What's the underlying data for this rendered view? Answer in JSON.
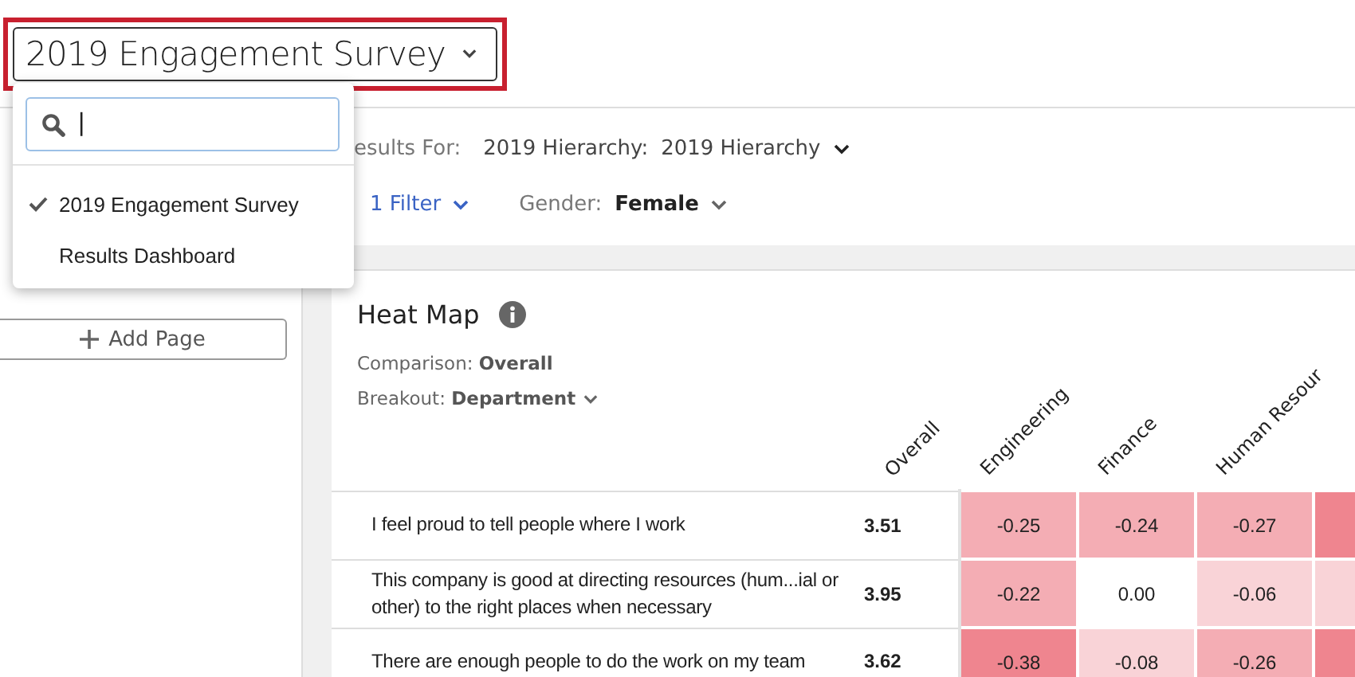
{
  "survey_selector": {
    "label": "2019 Engagement Survey",
    "highlighted": true
  },
  "dropdown": {
    "search": {
      "value": "|"
    },
    "items": [
      {
        "label": "2019 Engagement Survey",
        "selected": true
      },
      {
        "label": "Results Dashboard",
        "selected": false
      }
    ]
  },
  "sidebar": {
    "add_page": "Add Page"
  },
  "filter_bar": {
    "results_for_label": "esults For:",
    "hierarchy": "2019 Hierarchy:",
    "hierarchy_value": "2019 Hierarchy",
    "filter_count": "1 Filter",
    "gender_label": "Gender:",
    "gender_value": "Female"
  },
  "heat_map": {
    "title": "Heat Map",
    "comparison_label": "Comparison:",
    "comparison_value": "Overall",
    "breakout_label": "Breakout:",
    "breakout_value": "Department",
    "overall_column": "Overall",
    "columns": [
      "Engineering",
      "Finance",
      "Human Resour"
    ],
    "rows": [
      {
        "question": "I feel proud to tell people where I work",
        "overall": "3.51",
        "cells": [
          {
            "value": "-0.25",
            "color": "#f4adb4"
          },
          {
            "value": "-0.24",
            "color": "#f4adb4"
          },
          {
            "value": "-0.27",
            "color": "#f4adb4"
          },
          {
            "color": "#ef858f"
          }
        ]
      },
      {
        "question": "This company is good at directing resources (hum...ial or other) to the right places when necessary",
        "overall": "3.95",
        "cells": [
          {
            "value": "-0.22",
            "color": "#f4adb4"
          },
          {
            "value": "0.00",
            "color": "#ffffff"
          },
          {
            "value": "-0.06",
            "color": "#f9d3d7"
          },
          {
            "color": "#f9d3d7"
          }
        ]
      },
      {
        "question": "There are enough people to do the work on my team",
        "overall": "3.62",
        "cells": [
          {
            "value": "-0.38",
            "color": "#ef858f"
          },
          {
            "value": "-0.08",
            "color": "#f9d3d7"
          },
          {
            "value": "-0.26",
            "color": "#f4adb4"
          },
          {
            "color": "#ef858f"
          }
        ]
      }
    ]
  }
}
